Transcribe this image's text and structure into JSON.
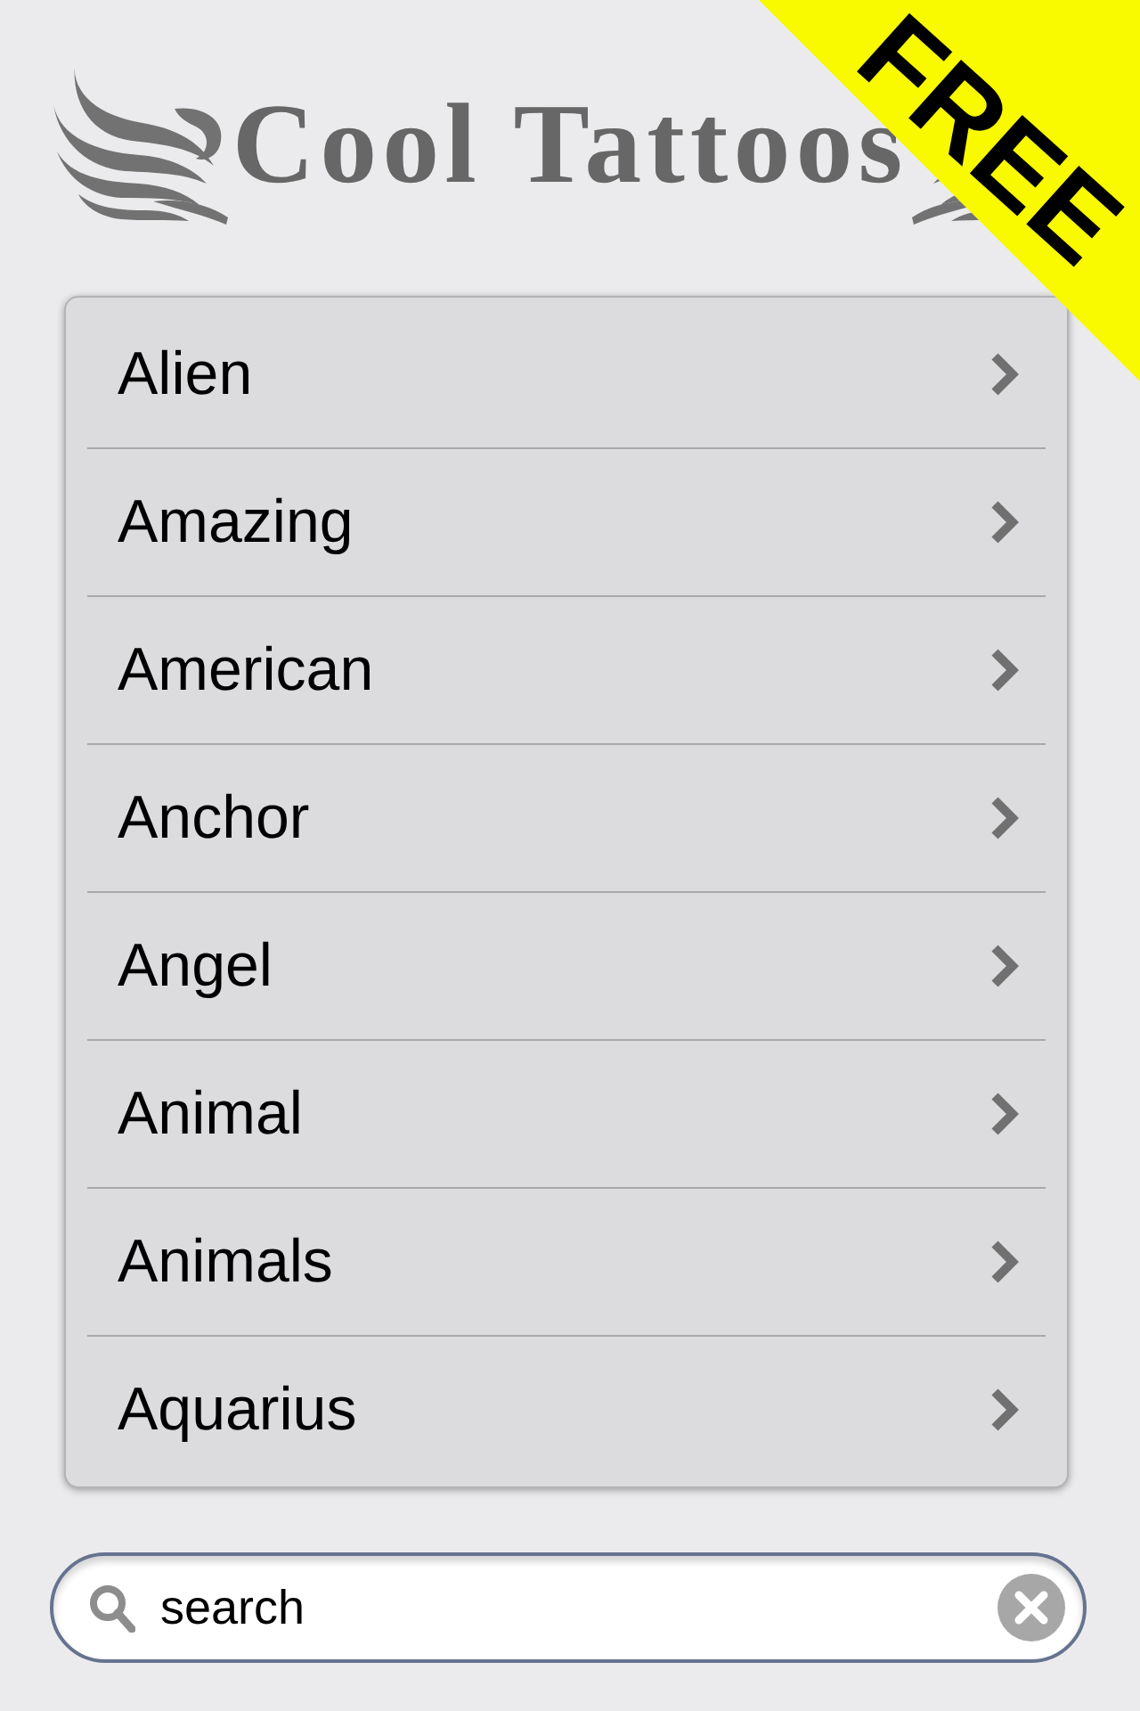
{
  "header": {
    "title": "Cool Tattoos",
    "ribbon": "FREE"
  },
  "categories": [
    {
      "label": "Alien"
    },
    {
      "label": "Amazing"
    },
    {
      "label": "American"
    },
    {
      "label": "Anchor"
    },
    {
      "label": "Angel"
    },
    {
      "label": "Animal"
    },
    {
      "label": "Animals"
    },
    {
      "label": "Aquarius"
    }
  ],
  "search": {
    "value": "search"
  }
}
